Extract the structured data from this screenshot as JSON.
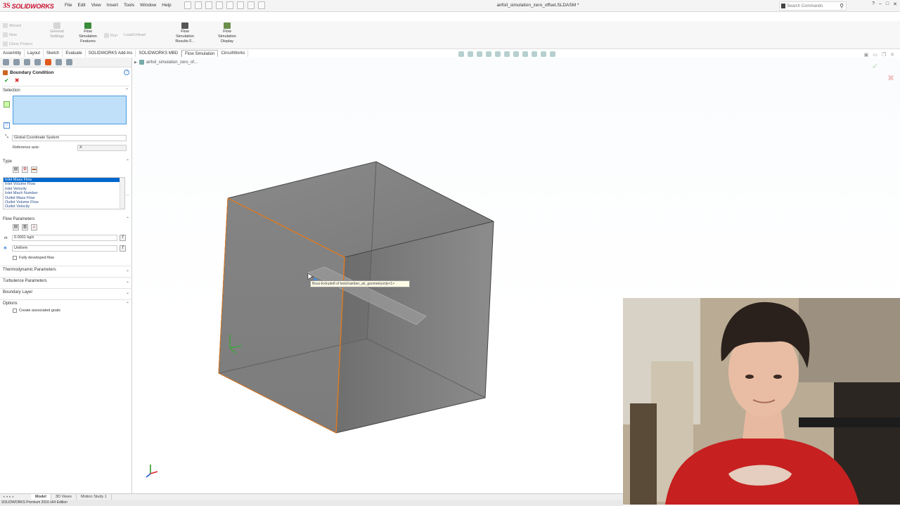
{
  "app": {
    "logo_text": "SOLIDWORKS",
    "menu": [
      "File",
      "Edit",
      "View",
      "Insert",
      "Tools",
      "Window",
      "Help"
    ],
    "document_title": "airfoil_simulation_zero_offset.SLDASM *",
    "search_placeholder": "Search Commands",
    "window_controls": [
      "?",
      "–",
      "□",
      "✕"
    ]
  },
  "command_manager": {
    "left_items": [
      "Wizard",
      "New",
      "Clone Project"
    ],
    "general_settings": "General Settings",
    "flow_simulation_features": "Flow Simulation Features",
    "run": "Run",
    "load_unload": "Load/Unload",
    "flow_simulation_results": "Flow Simulation Results F...",
    "flow_simulation_display": "Flow Simulation Display"
  },
  "tabs": [
    "Assembly",
    "Layout",
    "Sketch",
    "Evaluate",
    "SOLIDWORKS Add-Ins",
    "SOLIDWORKS MBD",
    "Flow Simulation",
    "CircuitWorks"
  ],
  "active_tab": "Flow Simulation",
  "feature_tree_path": "airfoil_simulation_zero_of...",
  "property_manager": {
    "title": "Boundary Condition",
    "selection_label": "Selection",
    "coordinate_system": "Global Coordinate System",
    "reference_axis_label": "Reference axis:",
    "reference_axis_value": "X",
    "type_label": "Type",
    "type_options": [
      "Inlet Mass Flow",
      "Inlet Volume Flow",
      "Inlet Velocity",
      "Inlet Mach Number",
      "Outlet Mass Flow",
      "Outlet Volume Flow",
      "Outlet Velocity"
    ],
    "type_selected": "Inlet Mass Flow",
    "flow_parameters_label": "Flow Parameters",
    "mass_flow_value": "0.0001 kg/s",
    "profile_value": "Uniform",
    "fully_developed_flow": "Fully developed flow",
    "thermodynamic_parameters": "Thermodynamic Parameters",
    "turbulence_parameters": "Turbulence Parameters",
    "boundary_layer": "Boundary Layer",
    "options_label": "Options",
    "create_goals": "Create associated goals"
  },
  "tooltip": "Boss-Extrude8 of testchamber_air_geometryonly<1>",
  "bottom_tabs": [
    "Model",
    "3D Views",
    "Motion Study 1"
  ],
  "active_bottom_tab": "Model",
  "status_text": "SOLIDWORKS Premium 2016 x64 Edition"
}
